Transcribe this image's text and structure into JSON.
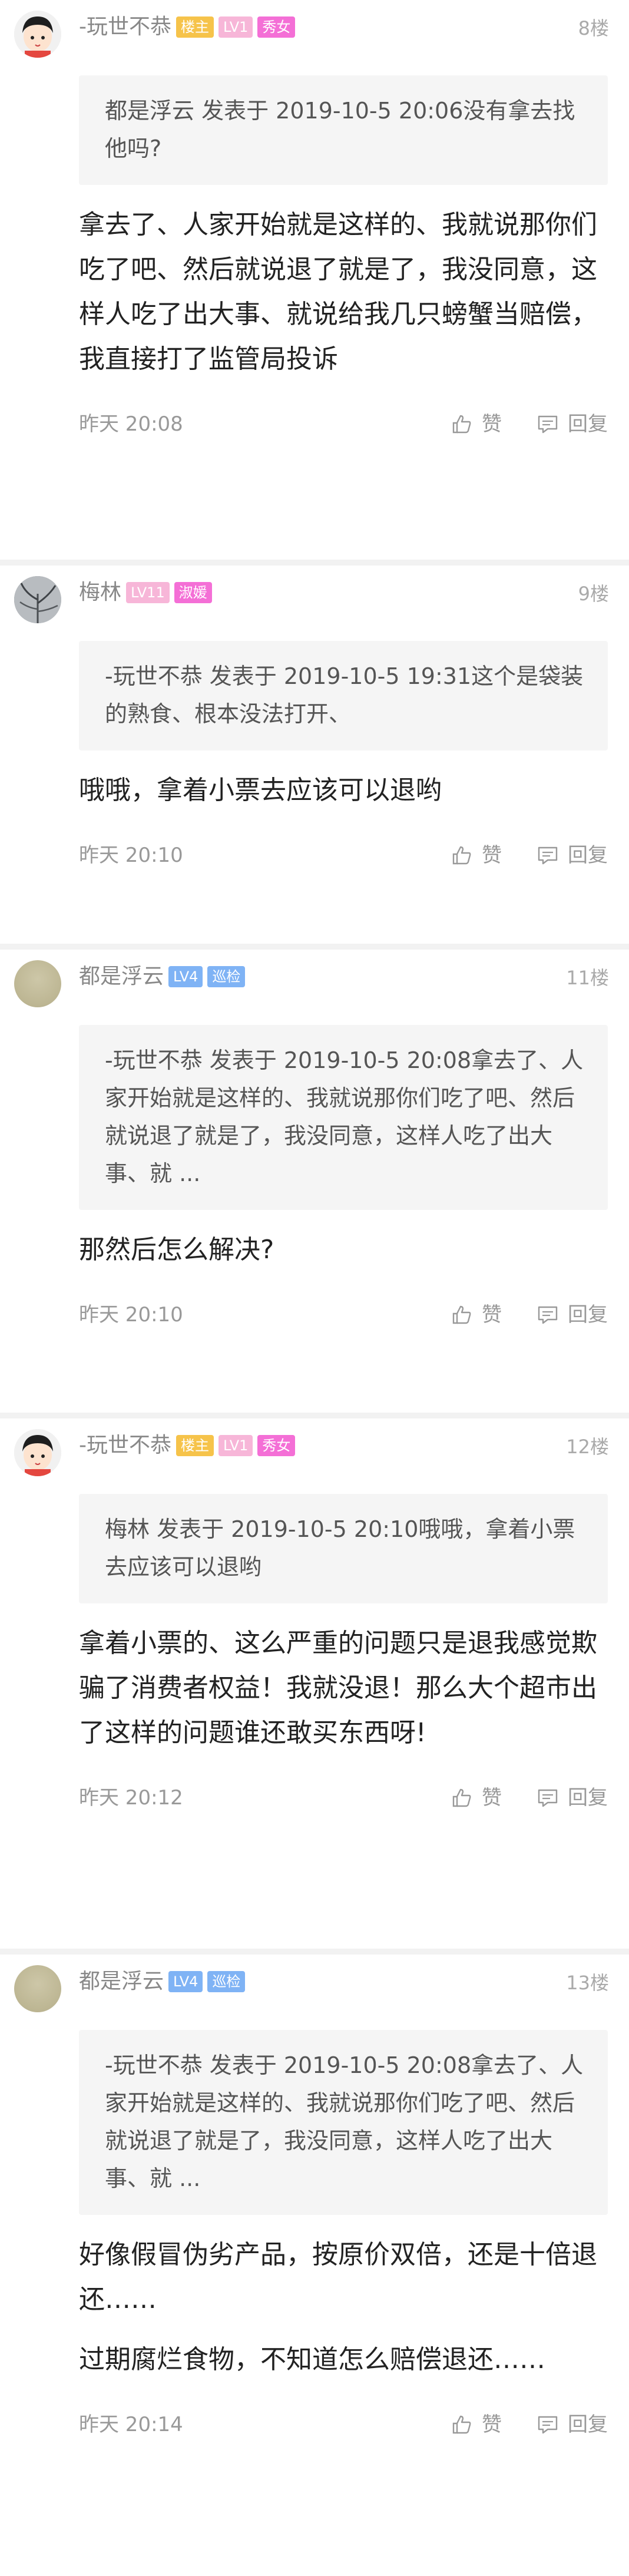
{
  "posts": [
    {
      "user": {
        "name": "-玩世不恭",
        "badges": [
          "楼主",
          "LV1",
          "秀女"
        ]
      },
      "floor": "8楼",
      "quote": "都是浮云 发表于 2019-10-5 20:06没有拿去找他吗?",
      "paragraphs": [
        "拿去了、人家开始就是这样的、我就说那你们吃了吧、然后就说退了就是了，我没同意，这样人吃了出大事、就说给我几只螃蟹当赔偿，我直接打了监管局投诉"
      ],
      "time": "昨天 20:08",
      "like_label": "赞",
      "reply_label": "回复"
    },
    {
      "user": {
        "name": "梅林",
        "badges": [
          "LV11",
          "淑媛"
        ]
      },
      "floor": "9楼",
      "quote": "-玩世不恭 发表于 2019-10-5 19:31这个是袋装的熟食、根本没法打开、",
      "paragraphs": [
        "哦哦，拿着小票去应该可以退哟"
      ],
      "time": "昨天 20:10",
      "like_label": "赞",
      "reply_label": "回复"
    },
    {
      "user": {
        "name": "都是浮云",
        "badges": [
          "LV4",
          "巡检"
        ]
      },
      "floor": "11楼",
      "quote": "-玩世不恭 发表于 2019-10-5 20:08拿去了、人家开始就是这样的、我就说那你们吃了吧、然后就说退了就是了，我没同意，这样人吃了出大事、就 ...",
      "paragraphs": [
        "那然后怎么解决?"
      ],
      "time": "昨天 20:10",
      "like_label": "赞",
      "reply_label": "回复"
    },
    {
      "user": {
        "name": "-玩世不恭",
        "badges": [
          "楼主",
          "LV1",
          "秀女"
        ]
      },
      "floor": "12楼",
      "quote": "梅林 发表于 2019-10-5 20:10哦哦，拿着小票去应该可以退哟",
      "paragraphs": [
        "拿着小票的、这么严重的问题只是退我感觉欺骗了消费者权益！我就没退！那么大个超市出了这样的问题谁还敢买东西呀!"
      ],
      "time": "昨天 20:12",
      "like_label": "赞",
      "reply_label": "回复"
    },
    {
      "user": {
        "name": "都是浮云",
        "badges": [
          "LV4",
          "巡检"
        ]
      },
      "floor": "13楼",
      "quote": "-玩世不恭 发表于 2019-10-5 20:08拿去了、人家开始就是这样的、我就说那你们吃了吧、然后就说退了就是了，我没同意，这样人吃了出大事、就 ...",
      "paragraphs": [
        "好像假冒伪劣产品，按原价双倍，还是十倍退还……",
        "过期腐烂食物，不知道怎么赔偿退还……"
      ],
      "time": "昨天 20:14",
      "like_label": "赞",
      "reply_label": "回复"
    }
  ],
  "colors": {
    "badge_host": "#f6c34a",
    "badge_level_pink": "#f7b6d8",
    "badge_title_magenta": "#f46fd6",
    "badge_level_blue": "#7fb3f5",
    "quote_bg": "#f5f5f5",
    "separator": "#f2f2f2"
  },
  "icons": {
    "like": "thumbs-up-icon",
    "reply": "comment-icon"
  }
}
